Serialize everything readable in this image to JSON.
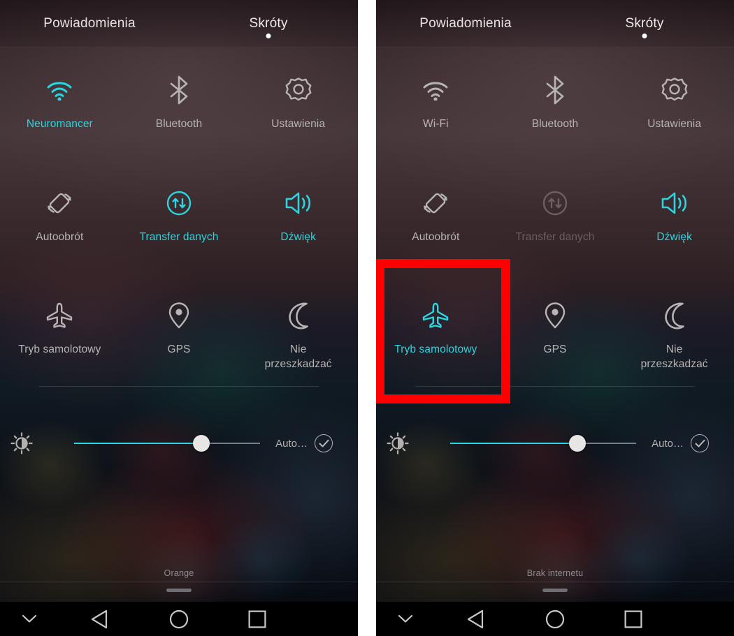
{
  "accent_color": "#2ad6e2",
  "off_color": "#b9b4b4",
  "disabled_color": "#6a5f62",
  "highlight_color": "#fe0000",
  "panels": [
    {
      "id": "left",
      "tabs": {
        "notifications": "Powiadomienia",
        "shortcuts": "Skróty",
        "active": "Skróty"
      },
      "tiles": [
        {
          "icon": "wifi-icon",
          "label": "Neuromancer",
          "state": "on"
        },
        {
          "icon": "bluetooth-icon",
          "label": "Bluetooth",
          "state": "off"
        },
        {
          "icon": "settings-gear-icon",
          "label": "Ustawienia",
          "state": "off"
        },
        {
          "icon": "auto-rotate-icon",
          "label": "Autoobrót",
          "state": "off"
        },
        {
          "icon": "data-transfer-icon",
          "label": "Transfer danych",
          "state": "on"
        },
        {
          "icon": "sound-icon",
          "label": "Dźwięk",
          "state": "on"
        },
        {
          "icon": "airplane-icon",
          "label": "Tryb samolotowy",
          "state": "off"
        },
        {
          "icon": "gps-pin-icon",
          "label": "GPS",
          "state": "off"
        },
        {
          "icon": "do-not-disturb-moon-icon",
          "label": "Nie przeszkadzać",
          "state": "off"
        }
      ],
      "brightness": {
        "icon": "brightness-sun-icon",
        "value_percent": 58,
        "auto_label": "Auto…",
        "auto_checked": true
      },
      "carrier": "Orange",
      "navbar": {
        "collapse": "chevron-down-icon",
        "back": "back-triangle-icon",
        "home": "home-circle-icon",
        "recents": "recents-square-icon"
      }
    },
    {
      "id": "right",
      "tabs": {
        "notifications": "Powiadomienia",
        "shortcuts": "Skróty",
        "active": "Skróty"
      },
      "tiles": [
        {
          "icon": "wifi-icon",
          "label": "Wi-Fi",
          "state": "off"
        },
        {
          "icon": "bluetooth-icon",
          "label": "Bluetooth",
          "state": "off"
        },
        {
          "icon": "settings-gear-icon",
          "label": "Ustawienia",
          "state": "off"
        },
        {
          "icon": "auto-rotate-icon",
          "label": "Autoobrót",
          "state": "off"
        },
        {
          "icon": "data-transfer-icon",
          "label": "Transfer danych",
          "state": "disabled"
        },
        {
          "icon": "sound-icon",
          "label": "Dźwięk",
          "state": "on"
        },
        {
          "icon": "airplane-icon",
          "label": "Tryb samolotowy",
          "state": "on"
        },
        {
          "icon": "gps-pin-icon",
          "label": "GPS",
          "state": "off"
        },
        {
          "icon": "do-not-disturb-moon-icon",
          "label": "Nie przeszkadzać",
          "state": "off"
        }
      ],
      "brightness": {
        "icon": "brightness-sun-icon",
        "value_percent": 58,
        "auto_label": "Auto…",
        "auto_checked": true
      },
      "carrier": "Brak internetu",
      "navbar": {
        "collapse": "chevron-down-icon",
        "back": "back-triangle-icon",
        "home": "home-circle-icon",
        "recents": "recents-square-icon"
      }
    }
  ]
}
